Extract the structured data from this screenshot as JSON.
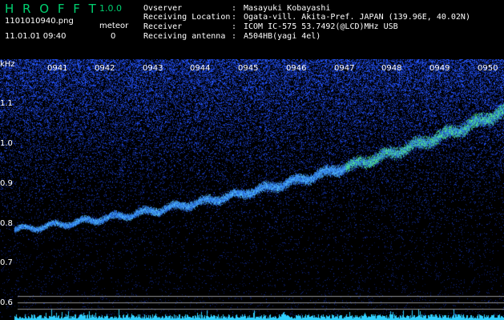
{
  "header": {
    "app_name": "H R O F F T",
    "version": "1.0.0",
    "filename": "1101010940.png",
    "datetime": "11.01.01 09:40",
    "meteor_label": "meteor",
    "meteor_count": "0"
  },
  "info": [
    {
      "label": "Ovserver",
      "colon": ":",
      "value": "Masayuki Kobayashi"
    },
    {
      "label": "Receiving Location",
      "colon": ":",
      "value": "Ogata-vill. Akita-Pref. JAPAN (139.96E, 40.02N)"
    },
    {
      "label": "Receiver",
      "colon": ":",
      "value": "ICOM IC-575 53.7492(@LCD)MHz USB"
    },
    {
      "label": "Receiving antenna",
      "colon": ":",
      "value": "A504HB(yagi 4el)"
    }
  ],
  "spectrogram": {
    "unit_label": "kHz",
    "time_labels": [
      "0941",
      "0942",
      "0943",
      "0944",
      "0945",
      "0946",
      "0947",
      "0948",
      "0949",
      "0950"
    ],
    "freq_labels": [
      "1.1",
      "1.0",
      "0.9",
      "0.8",
      "0.7",
      "0.6"
    ],
    "colors": {
      "background": "#000000",
      "noise": "#1030a0",
      "signal": "#40c0ff",
      "hot": "#60ff80",
      "baseline": "#a0a0a0"
    }
  }
}
